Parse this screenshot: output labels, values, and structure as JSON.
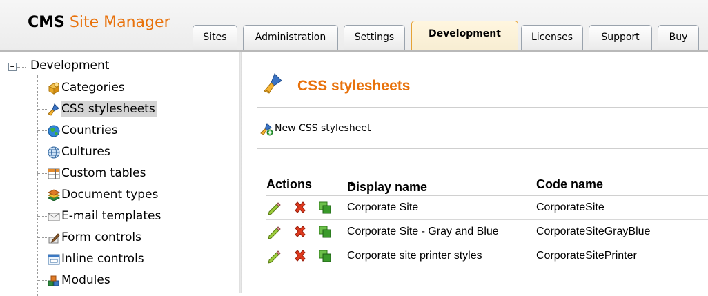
{
  "header": {
    "logo_cms": "CMS",
    "logo_site_manager": "Site Manager",
    "tabs": [
      {
        "label": "Sites",
        "active": false
      },
      {
        "label": "Administration",
        "active": false
      },
      {
        "label": "Settings",
        "active": false
      },
      {
        "label": "Development",
        "active": true
      },
      {
        "label": "Licenses",
        "active": false
      },
      {
        "label": "Support",
        "active": false
      },
      {
        "label": "Buy",
        "active": false
      }
    ]
  },
  "tree": {
    "root_label": "Development",
    "collapse_symbol": "−",
    "items": [
      {
        "label": "Categories",
        "icon": "categories-icon"
      },
      {
        "label": "CSS stylesheets",
        "icon": "css-stylesheets-icon",
        "selected": true
      },
      {
        "label": "Countries",
        "icon": "globe-icon"
      },
      {
        "label": "Cultures",
        "icon": "cultures-icon"
      },
      {
        "label": "Custom tables",
        "icon": "custom-tables-icon"
      },
      {
        "label": "Document types",
        "icon": "document-types-icon"
      },
      {
        "label": "E-mail templates",
        "icon": "email-templates-icon"
      },
      {
        "label": "Form controls",
        "icon": "form-controls-icon"
      },
      {
        "label": "Inline controls",
        "icon": "inline-controls-icon"
      },
      {
        "label": "Modules",
        "icon": "modules-icon"
      }
    ]
  },
  "content": {
    "title": "CSS stylesheets",
    "new_link": "New CSS stylesheet",
    "grid": {
      "headers": {
        "actions": "Actions",
        "display_name": "Display name",
        "code_name": "Code name",
        "sort_indicator": "▲"
      },
      "rows": [
        {
          "display_name": "Corporate Site",
          "code_name": "CorporateSite"
        },
        {
          "display_name": "Corporate Site - Gray and Blue",
          "code_name": "CorporateSiteGrayBlue"
        },
        {
          "display_name": "Corporate site printer styles",
          "code_name": "CorporateSitePrinter"
        }
      ]
    }
  },
  "colors": {
    "accent_orange": "#e8720c",
    "selected_bg": "#d4d4d4",
    "active_tab_border": "#e6a335"
  }
}
